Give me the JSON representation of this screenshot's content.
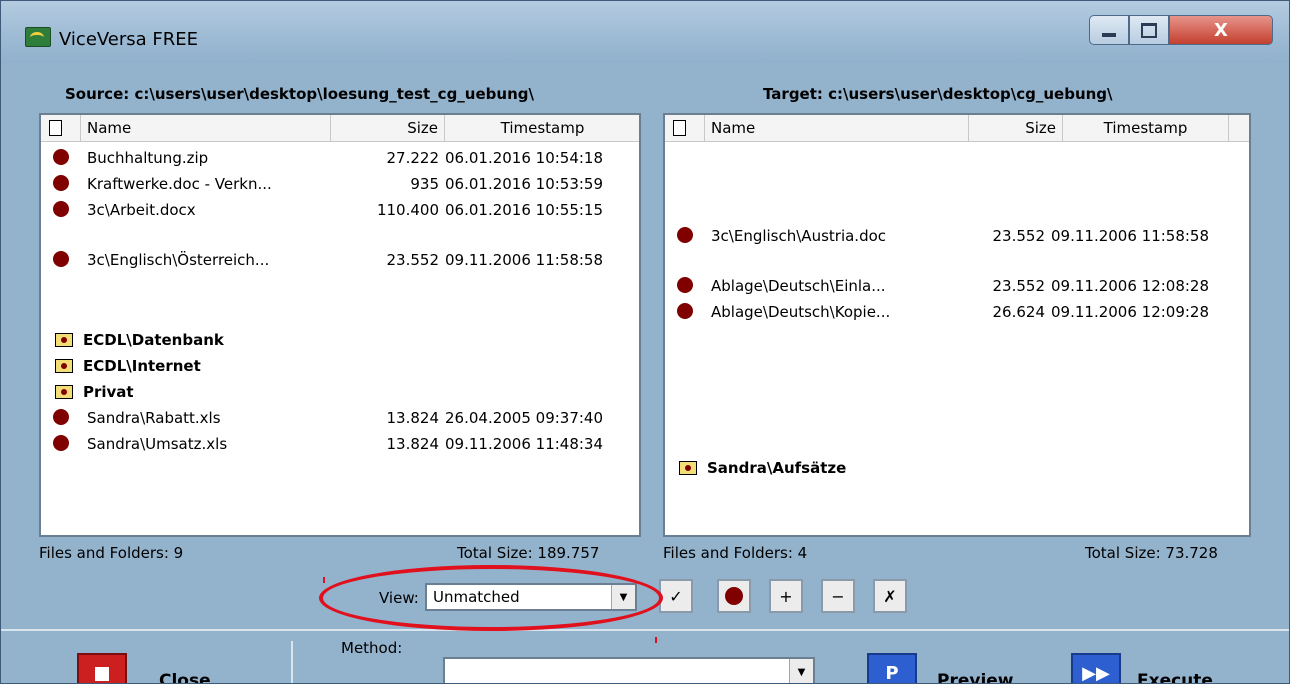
{
  "window": {
    "title": "ViceVersa FREE",
    "icons": {
      "app": "viceversa-app-icon",
      "minimize": "minimize-icon",
      "maximize": "maximize-icon",
      "close": "close-icon"
    },
    "close_glyph": "X"
  },
  "source": {
    "label": "Source:  c:\\users\\user\\desktop\\loesung_test_cg_uebung\\",
    "columns": {
      "name": "Name",
      "size": "Size",
      "timestamp": "Timestamp"
    },
    "rows": [
      {
        "kind": "file",
        "name": "Buchhaltung.zip",
        "size": "27.222",
        "timestamp": "06.01.2016 10:54:18"
      },
      {
        "kind": "file",
        "name": "Kraftwerke.doc - Verkn...",
        "size": "935",
        "timestamp": "06.01.2016 10:53:59"
      },
      {
        "kind": "file",
        "name": "3c\\Arbeit.docx",
        "size": "110.400",
        "timestamp": "06.01.2016 10:55:15"
      },
      {
        "kind": "file",
        "name": "3c\\Englisch\\Österreich...",
        "size": "23.552",
        "timestamp": "09.11.2006 11:58:58"
      },
      {
        "kind": "folder",
        "name": "ECDL\\Datenbank"
      },
      {
        "kind": "folder",
        "name": "ECDL\\Internet"
      },
      {
        "kind": "folder",
        "name": "Privat"
      },
      {
        "kind": "file",
        "name": "Sandra\\Rabatt.xls",
        "size": "13.824",
        "timestamp": "26.04.2005 09:37:40"
      },
      {
        "kind": "file",
        "name": "Sandra\\Umsatz.xls",
        "size": "13.824",
        "timestamp": "09.11.2006 11:48:34"
      }
    ],
    "files_and_folders": "Files and Folders: 9",
    "total_size": "Total Size: 189.757"
  },
  "target": {
    "label": "Target:  c:\\users\\user\\desktop\\cg_uebung\\",
    "columns": {
      "name": "Name",
      "size": "Size",
      "timestamp": "Timestamp"
    },
    "rows": [
      {
        "kind": "file",
        "name": "3c\\Englisch\\Austria.doc",
        "size": "23.552",
        "timestamp": "09.11.2006 11:58:58"
      },
      {
        "kind": "file",
        "name": "Ablage\\Deutsch\\Einla...",
        "size": "23.552",
        "timestamp": "09.11.2006 12:08:28"
      },
      {
        "kind": "file",
        "name": "Ablage\\Deutsch\\Kopie...",
        "size": "26.624",
        "timestamp": "09.11.2006 12:09:28"
      },
      {
        "kind": "folder",
        "name": "Sandra\\Aufsätze"
      }
    ],
    "files_and_folders": "Files and Folders: 4",
    "total_size": "Total Size: 73.728"
  },
  "view": {
    "label": "View:",
    "selected": "Unmatched"
  },
  "toolbar_icons": [
    "checkmark-icon",
    "red-dot-icon",
    "plus-icon",
    "minus-icon",
    "exclude-icon"
  ],
  "toolbar_glyphs": {
    "check": "✓",
    "plus": "+",
    "minus": "−",
    "exclude": "✗"
  },
  "actions": {
    "close_label": "Close",
    "method_label": "Method:",
    "method_value": "",
    "preview_label": "Preview",
    "execute_label": "Execute",
    "preview_glyph": "P",
    "execute_glyph": "▶▶"
  },
  "colors": {
    "window_bg": "#93b2cc",
    "status_dot": "#800000",
    "highlight": "#e0101c",
    "close_button": "#cc1f1f",
    "action_blue": "#2e5fd1"
  }
}
